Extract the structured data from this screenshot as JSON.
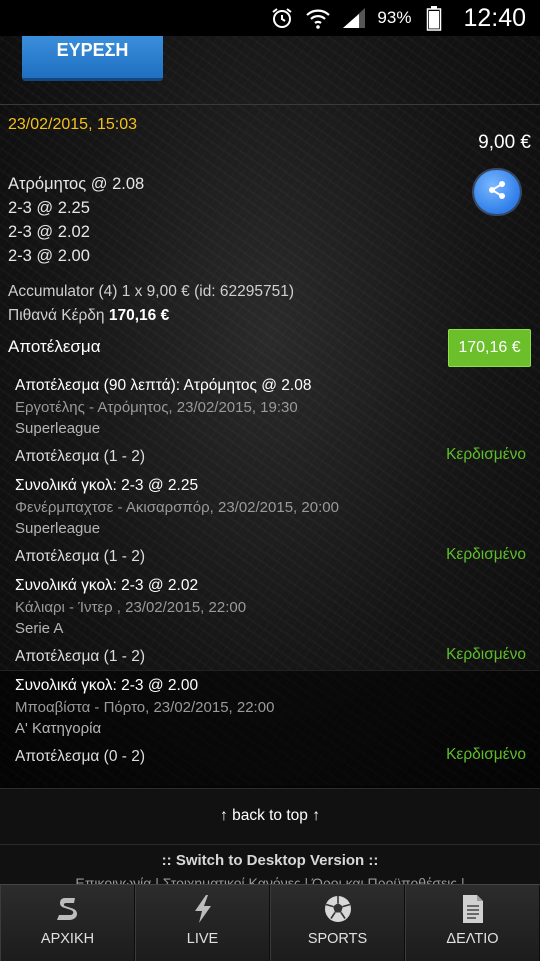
{
  "status_bar": {
    "battery_percent": "93%",
    "time": "12:40"
  },
  "search": {
    "button_label": "ΕΥΡΕΣΗ"
  },
  "ticket": {
    "date": "23/02/2015, 15:03",
    "stake": "9,00 €",
    "selections": [
      "Ατρόμητος @ 2.08",
      "2-3 @ 2.25",
      "2-3 @ 2.02",
      "2-3 @ 2.00"
    ],
    "accumulator_text": "Accumulator (4) 1 x 9,00 € (id: 62295751)",
    "potential_win_label": "Πιθανά Κέρδη",
    "potential_win_value": "170,16 €",
    "result_heading": "Αποτέλεσμα",
    "result_badge": "170,16 €"
  },
  "bets": [
    {
      "market": "Αποτέλεσμα (90 λεπτά): Ατρόμητος @ 2.08",
      "event": "Εργοτέλης - Ατρόμητος, 23/02/2015, 19:30",
      "league": "Superleague",
      "outcome": "Αποτέλεσμα (1 - 2)",
      "status": "Κερδισμένο"
    },
    {
      "market": "Συνολικά γκολ: 2-3 @ 2.25",
      "event": "Φενέρμπαχτσε - Ακισαρσπόρ, 23/02/2015, 20:00",
      "league": "Superleague",
      "outcome": "Αποτέλεσμα (1 - 2)",
      "status": "Κερδισμένο"
    },
    {
      "market": "Συνολικά γκολ: 2-3 @ 2.02",
      "event": "Κάλιαρι - Ίντερ , 23/02/2015, 22:00",
      "league": "Serie A",
      "outcome": "Αποτέλεσμα (1 - 2)",
      "status": "Κερδισμένο"
    },
    {
      "market": "Συνολικά γκολ: 2-3 @ 2.00",
      "event": "Μποαβίστα - Πόρτο, 23/02/2015, 22:00",
      "league": "Α' Κατηγορία",
      "outcome": "Αποτέλεσμα (0 - 2)",
      "status": "Κερδισμένο"
    }
  ],
  "footer": {
    "back_to_top": "↑ back to top ↑",
    "desktop_switch": ":: Switch to Desktop Version ::",
    "links": "Επικοινωνία | Στοιχηματικοί Κανόνες | Όροι και Προϋποθέσεις |"
  },
  "tabbar": {
    "items": [
      {
        "label": "ΑΡΧΙΚΗ",
        "icon": "home-s-logo-icon"
      },
      {
        "label": "LIVE",
        "icon": "lightning-icon"
      },
      {
        "label": "SPORTS",
        "icon": "soccer-ball-icon"
      },
      {
        "label": "ΔΕΛΤΙΟ",
        "icon": "document-icon"
      }
    ]
  },
  "colors": {
    "accent_yellow": "#f2c21b",
    "win_green": "#5fbf2a",
    "badge_green": "#6abf2a",
    "button_blue": "#2a7fd0"
  }
}
